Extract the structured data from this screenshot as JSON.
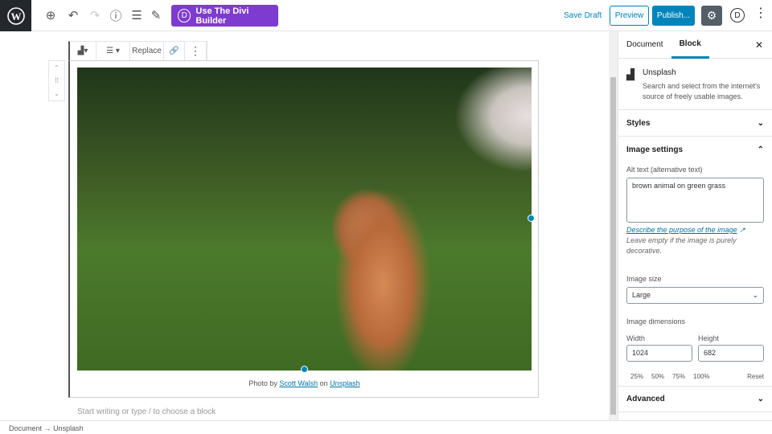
{
  "topbar": {
    "divi_label": "Use The Divi Builder",
    "divi_letter": "D",
    "save_draft": "Save Draft",
    "preview": "Preview",
    "publish": "Publish...",
    "divi_circle": "D"
  },
  "block_toolbar": {
    "replace": "Replace"
  },
  "image": {
    "caption_prefix": "Photo by ",
    "author": "Scott Walsh",
    "caption_mid": " on ",
    "source": "Unsplash",
    "alt": "brown animal on green grass"
  },
  "editor": {
    "placeholder": "Start writing or type / to choose a block"
  },
  "sidebar": {
    "tabs": [
      "Document",
      "Block"
    ],
    "block_name": "Unsplash",
    "block_desc": "Search and select from the internet's source of freely usable images.",
    "styles": "Styles",
    "image_settings": "Image settings",
    "alt_label": "Alt text (alternative text)",
    "alt_value": "brown animal on green grass",
    "describe_link": "Describe the purpose of the image",
    "describe_rest": " Leave empty if the image is purely decorative.",
    "size_label": "Image size",
    "size_value": "Large",
    "dimensions_label": "Image dimensions",
    "width_label": "Width",
    "height_label": "Height",
    "width_value": "1024",
    "height_value": "682",
    "percents": [
      "25%",
      "50%",
      "75%",
      "100%"
    ],
    "reset": "Reset",
    "advanced": "Advanced"
  },
  "status": {
    "doc": "Document",
    "arrow": "→",
    "block": "Unsplash"
  },
  "colors": {
    "accent": "#0085ba",
    "divi": "#7e3bd0"
  }
}
